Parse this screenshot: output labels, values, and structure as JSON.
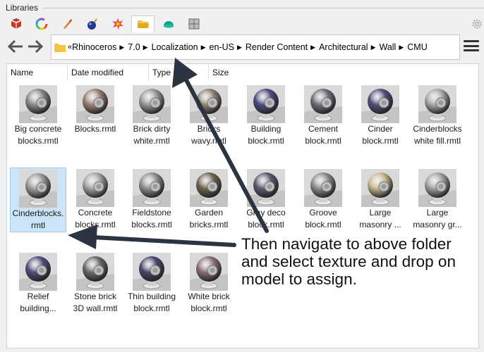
{
  "panel": {
    "title": "Libraries"
  },
  "tabs": [
    {
      "name": "materials-tab",
      "icon": "materials-icon"
    },
    {
      "name": "environments-tab",
      "icon": "color-wheel-icon"
    },
    {
      "name": "textures-tab",
      "icon": "paint-tube-icon"
    },
    {
      "name": "effects-tab",
      "icon": "bomb-icon"
    },
    {
      "name": "sun-tab",
      "icon": "splat-icon"
    },
    {
      "name": "libraries-tab",
      "icon": "folder-icon",
      "active": true
    },
    {
      "name": "renderer-tab",
      "icon": "dome-icon"
    },
    {
      "name": "layout-tab",
      "icon": "grid-icon"
    }
  ],
  "breadcrumb": {
    "chevron": "«",
    "segments": [
      "Rhinoceros",
      "7.0",
      "Localization",
      "en-US",
      "Render Content",
      "Architectural",
      "Wall",
      "CMU"
    ]
  },
  "columns": {
    "name": "Name",
    "date": "Date modified",
    "type": "Type",
    "size": "Size"
  },
  "items": [
    {
      "line1": "Big concrete",
      "line2": "blocks.rmtl",
      "color": "#8a8a8a"
    },
    {
      "line1": "Blocks.rmtl",
      "line2": "",
      "color": "#9b7f76"
    },
    {
      "line1": "Brick dirty",
      "line2": "white.rmtl",
      "color": "#9a9a9a"
    },
    {
      "line1": "Bricks",
      "line2": "wavy.rmtl",
      "color": "#8e8470"
    },
    {
      "line1": "Building",
      "line2": "block.rmtl",
      "color": "#4c4c80"
    },
    {
      "line1": "Cement",
      "line2": "block.rmtl",
      "color": "#6f6f7c"
    },
    {
      "line1": "Cinder",
      "line2": "block.rmtl",
      "color": "#50507a"
    },
    {
      "line1": "Cinderblocks",
      "line2": "white fill.rmtl",
      "color": "#a8a8a8"
    },
    {
      "line1": "Cinderblocks.",
      "line2": "rmtl",
      "color": "#9a9a9a",
      "selected": true
    },
    {
      "line1": "Concrete",
      "line2": "blocks.rmtl",
      "color": "#a5a5a5"
    },
    {
      "line1": "Fieldstone",
      "line2": "blocks.rmtl",
      "color": "#8f8f8f"
    },
    {
      "line1": "Garden",
      "line2": "bricks.rmtl",
      "color": "#6f6550"
    },
    {
      "line1": "Gray deco",
      "line2": "block.rmtl",
      "color": "#5a5a72"
    },
    {
      "line1": "Groove",
      "line2": "block.rmtl",
      "color": "#8d8d8d"
    },
    {
      "line1": "Large",
      "line2": "masonry ...",
      "color": "#c9b990"
    },
    {
      "line1": "Large",
      "line2": "masonry gr...",
      "color": "#a3a3a3"
    },
    {
      "line1": "Relief",
      "line2": "building...",
      "color": "#4f4f7a"
    },
    {
      "line1": "Stone brick",
      "line2": "3D wall.rmtl",
      "color": "#6a6a6a"
    },
    {
      "line1": "Thin building",
      "line2": "block.rmtl",
      "color": "#47476e"
    },
    {
      "line1": "White brick",
      "line2": "block.rmtl",
      "color": "#8c6f76"
    }
  ],
  "annotation": {
    "text": "Then navigate to above folder and select texture and drop on model to assign.",
    "color": "#2b3440"
  }
}
